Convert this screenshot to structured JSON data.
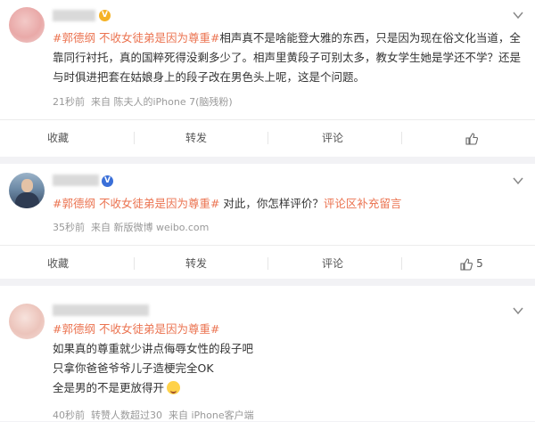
{
  "posts": [
    {
      "content_parts": [
        {
          "type": "tag",
          "text": "#郭德纲 不收女徒弟是因为尊重#"
        },
        {
          "type": "text",
          "text": "相声真不是啥能登大雅的东西，只是因为现在俗文化当道，全靠同行衬托，真的国粹死得没剩多少了。相声里黄段子可别太多，教女学生她是学还不学？还是与时俱进把套在姑娘身上的段子改在男色头上呢，这是个问题。"
        }
      ],
      "meta": {
        "time": "21秒前",
        "source": "来自 陈夫人的iPhone 7(脑残粉)"
      },
      "actions": {
        "collect": "收藏",
        "repost": "转发",
        "comment": "评论",
        "like": ""
      }
    },
    {
      "content_parts": [
        {
          "type": "tag",
          "text": "#郭德纲 不收女徒弟是因为尊重#"
        },
        {
          "type": "text",
          "text": " 对此，你怎样评价？"
        },
        {
          "type": "link",
          "text": "评论区补充留言"
        }
      ],
      "meta": {
        "time": "35秒前",
        "source": "来自 新版微博 weibo.com"
      },
      "actions": {
        "collect": "收藏",
        "repost": "转发",
        "comment": "评论",
        "like": "5"
      }
    },
    {
      "content_parts": [
        {
          "type": "tag",
          "text": "#郭德纲 不收女徒弟是因为尊重#"
        }
      ],
      "lines": [
        "如果真的尊重就少讲点侮辱女性的段子吧",
        "只拿你爸爸爷爷儿子造梗完全OK",
        "全是男的不是更放得开"
      ],
      "meta": {
        "time": "40秒前",
        "reposts": "转赞人数超过30",
        "source": "来自 iPhone客户端"
      }
    }
  ],
  "colors": {
    "accent": "#eb7350",
    "badge": "#f5b225",
    "meta": "#999999",
    "bg": "#f2f2f5"
  }
}
